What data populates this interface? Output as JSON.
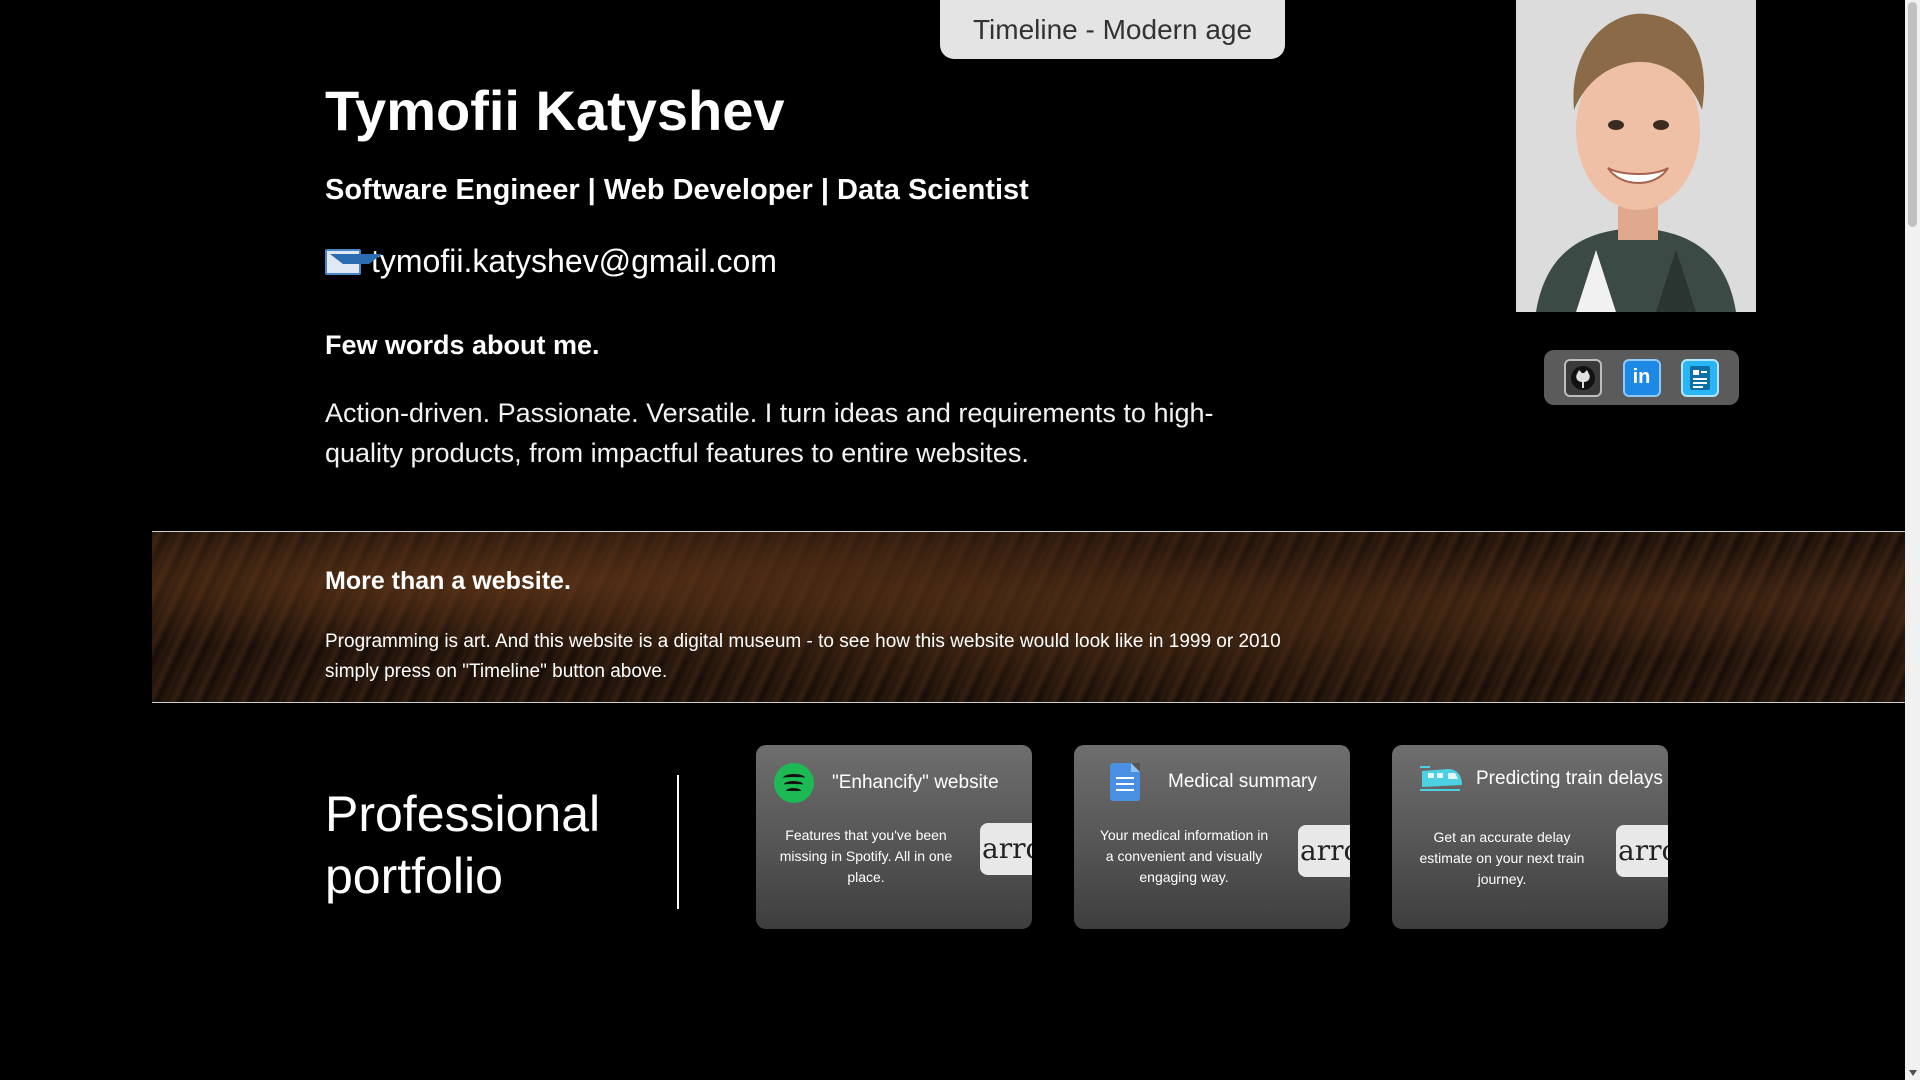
{
  "header": {
    "timeline_label": "Timeline - Modern age"
  },
  "hero": {
    "name": "Tymofii Katyshev",
    "roles": "Software Engineer | Web Developer | Data Scientist",
    "email": "tymofii.katyshev@gmail.com",
    "about_heading": "Few words about me.",
    "about_text": "Action-driven. Passionate. Versatile. I turn ideas and requirements to high-quality products, from impactful features to entire websites."
  },
  "social": {
    "icons": [
      "github-icon",
      "linkedin-icon",
      "resume-icon"
    ],
    "linkedin_glyph": "in"
  },
  "band": {
    "heading": "More than a website.",
    "text": "Programming is art. And this website is a digital museum - to see how this website would look like in 1999 or 2010 simply press on \"Timeline\" button above."
  },
  "portfolio": {
    "title_line1": "Professional",
    "title_line2": "portfolio",
    "cards": [
      {
        "title": "\"Enhancify\" website",
        "description": "Features that you've been missing in Spotify. All in one place.",
        "arrow_text": "arrow",
        "icon": "spotify-icon"
      },
      {
        "title": "Medical summary",
        "description": "Your medical information in a convenient and visually engaging way.",
        "arrow_text": "arrow",
        "icon": "document-icon"
      },
      {
        "title": "Predicting train delays",
        "description": "Get an accurate delay estimate on your next train journey.",
        "arrow_text": "arrow",
        "icon": "train-icon"
      }
    ]
  },
  "colors": {
    "background": "#000000",
    "timeline_button": "#e4e4e4",
    "card_gray": "#5e5e5e",
    "spotify_green": "#1db954",
    "linkedin_blue": "#1e88e5"
  }
}
